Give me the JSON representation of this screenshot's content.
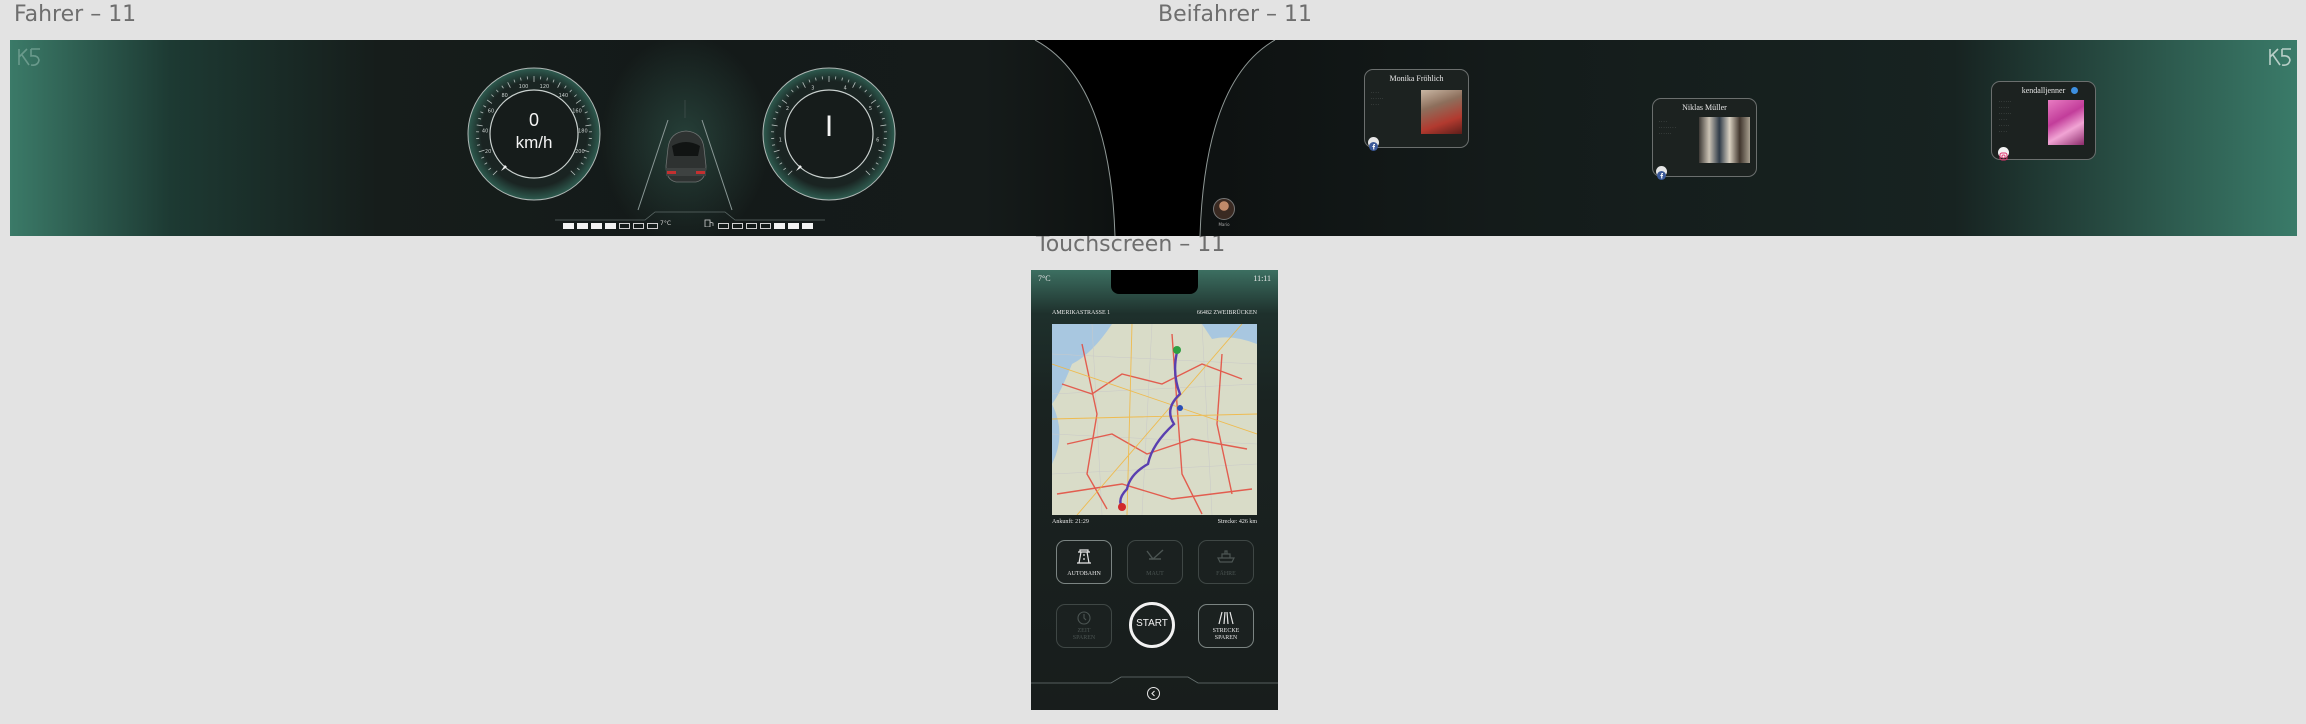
{
  "artboards": {
    "driver_label": "Fahrer – 11",
    "passenger_label": "Beifahrer – 11",
    "touch_label": "Touchscreen – 11"
  },
  "driver": {
    "speed_value": "0",
    "speed_unit": "km/h",
    "speed_ticks": [
      "20",
      "40",
      "60",
      "80",
      "100",
      "120",
      "140",
      "160",
      "180",
      "200"
    ],
    "gear": "I",
    "rpm_ticks": [
      "1",
      "2",
      "3",
      "4",
      "5",
      "6"
    ],
    "temperature": "7°C",
    "fuel_level_fraction": 0.5,
    "range_level_fraction": 0.45
  },
  "passenger": {
    "avatar_label": "Mario",
    "cards": [
      {
        "name": "Monika Fröhlich",
        "lines": [
          "·  ·  ·  ·",
          "· · · · · ·",
          "· · · ·"
        ],
        "network": "facebook",
        "icon_color": "#3b5998"
      },
      {
        "name": "Niklas Müller",
        "lines": [
          "·  ·  ·  ·",
          "· · · · · · · ·",
          "· · · · · ·"
        ],
        "network": "facebook",
        "icon_color": "#3b5998"
      },
      {
        "name": "kendalljenner",
        "lines": [
          "· · · · · ·",
          "· · · · ·",
          "· · · · · ·",
          "· · · ·",
          "· · · · ·",
          "· · · ·"
        ],
        "network": "instagram",
        "icon_color": "#e1306c"
      }
    ]
  },
  "touch": {
    "temperature": "7°C",
    "time": "11:11",
    "street": "AMERIKASTRASSE 1",
    "city": "66482 ZWEIBRÜCKEN",
    "arrival": "Ankunft: 21:29",
    "distance": "Strecke: 426 km",
    "buttons": {
      "autobahn": "AUTOBAHN",
      "maut": "MAUT",
      "faehre": "FÄHRE",
      "zeit_1": "ZEIT",
      "zeit_2": "SPAREN",
      "start": "START",
      "strecke_1": "STRECKE",
      "strecke_2": "SPAREN"
    },
    "accent_color": "#e9ecec"
  },
  "icons": [
    "k5-logo-icon",
    "car-top-icon",
    "facebook-icon",
    "instagram-icon",
    "highway-icon",
    "toll-icon",
    "ferry-icon",
    "clock-icon",
    "road-icon",
    "back-chevron-icon"
  ]
}
